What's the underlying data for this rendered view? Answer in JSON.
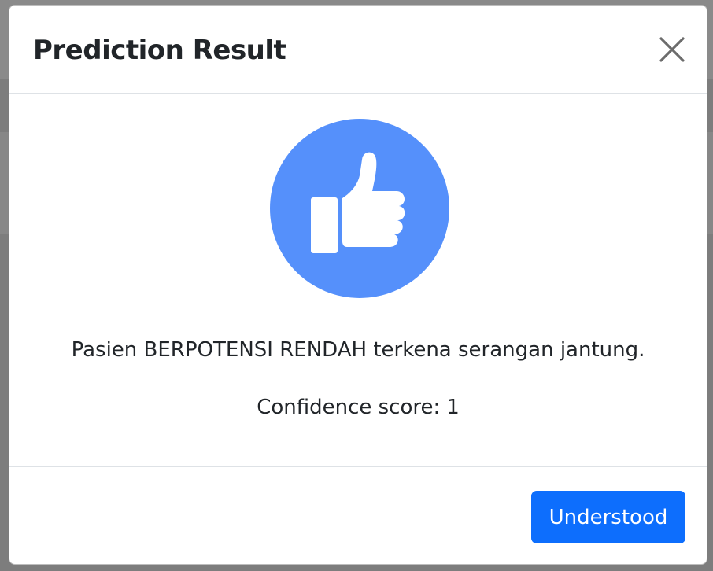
{
  "modal": {
    "title": "Prediction Result",
    "close_label": "Close"
  },
  "result": {
    "icon": "thumbs-up-icon",
    "message": "Pasien BERPOTENSI RENDAH terkena serangan jantung.",
    "confidence_label": "Confidence score:",
    "confidence_value": "1"
  },
  "footer": {
    "understood_label": "Understood"
  },
  "colors": {
    "icon_circle": "#5590fb",
    "primary_button": "#0d6efd",
    "backdrop": "#7d7d7d"
  }
}
